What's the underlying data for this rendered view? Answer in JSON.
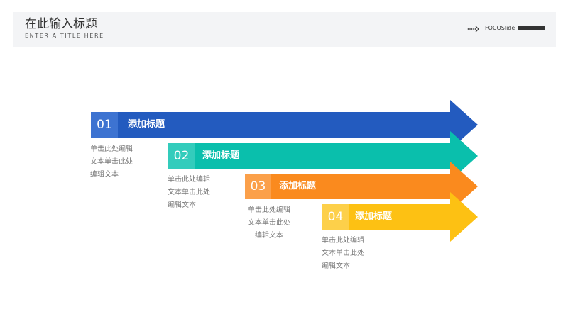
{
  "header": {
    "title": "在此输入标题",
    "subtitle": "ENTER A TITLE HERE",
    "brand": "FOCOSlide",
    "brand_color": "#333333"
  },
  "steps": [
    {
      "number": "01",
      "title": "添加标题",
      "desc": "单击此处编辑\n文本单击此处\n编辑文本",
      "color": "#235bbf",
      "tab_color": "#3d73d1"
    },
    {
      "number": "02",
      "title": "添加标题",
      "desc": "单击此处编辑\n文本单击此处\n编辑文本",
      "color": "#0abfac",
      "tab_color": "#33ccbc"
    },
    {
      "number": "03",
      "title": "添加标题",
      "desc": "单击此处编辑\n文本单击此处\n编辑文本",
      "color": "#fa8a1e",
      "tab_color": "#fba04a"
    },
    {
      "number": "04",
      "title": "添加标题",
      "desc": "单击此处编辑\n文本单击此处\n编辑文本",
      "color": "#fdc113",
      "tab_color": "#fdd04a"
    }
  ]
}
